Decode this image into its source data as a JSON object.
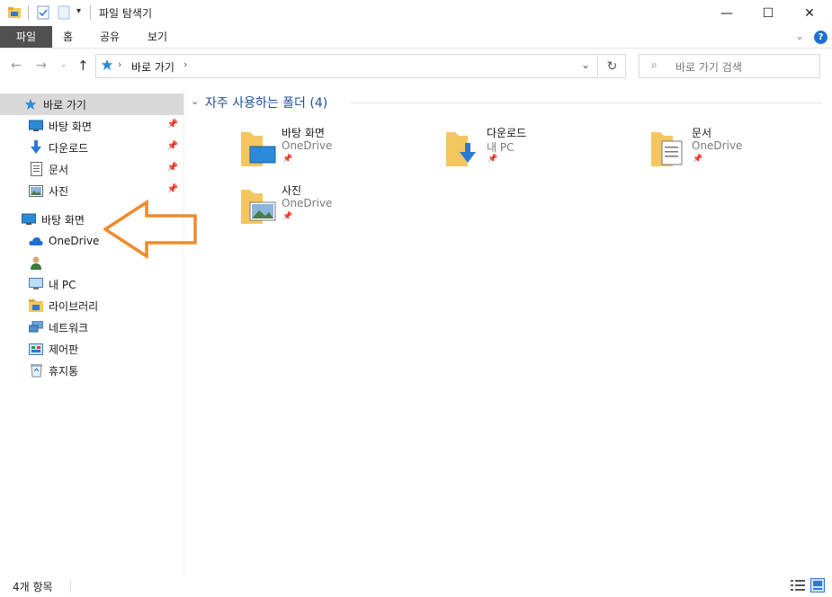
{
  "window": {
    "title": "파일 탐색기",
    "minimize": "—",
    "maximize": "☐",
    "close": "✕"
  },
  "ribbon": {
    "tabs": [
      {
        "label": "파일"
      },
      {
        "label": "홈"
      },
      {
        "label": "공유"
      },
      {
        "label": "보기"
      }
    ]
  },
  "address": {
    "crumb": "바로 가기",
    "search_placeholder": "바로 가기 검색"
  },
  "sidebar": {
    "quick_access": "바로 가기",
    "items": [
      {
        "label": "바탕 화면",
        "pinned": true
      },
      {
        "label": "다운로드",
        "pinned": true
      },
      {
        "label": "문서",
        "pinned": true
      },
      {
        "label": "사진",
        "pinned": true
      }
    ],
    "desktop": "바탕 화면",
    "onedrive": "OneDrive",
    "user": "",
    "this_pc": "내 PC",
    "libraries": "라이브러리",
    "network": "네트워크",
    "control_panel": "제어판",
    "recycle_bin": "휴지통"
  },
  "main": {
    "group_title": "자주 사용하는 폴더 (4)",
    "folders": [
      {
        "name": "바탕 화면",
        "location": "OneDrive"
      },
      {
        "name": "다운로드",
        "location": "내 PC"
      },
      {
        "name": "문서",
        "location": "OneDrive"
      },
      {
        "name": "사진",
        "location": "OneDrive"
      }
    ]
  },
  "status": {
    "item_count": "4개 항목"
  },
  "colors": {
    "accent": "#1e4e9c",
    "selected_bg": "#d9d9d9",
    "arrow": "#f08a2c",
    "folder": "#f4c660"
  }
}
